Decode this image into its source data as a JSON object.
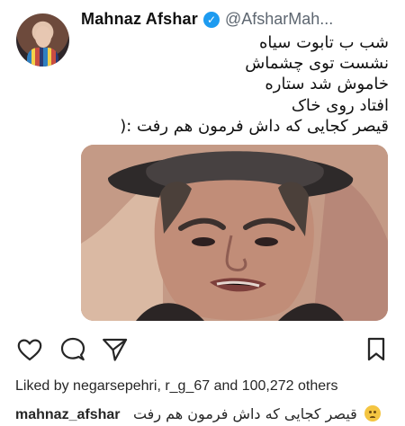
{
  "post": {
    "display_name": "Mahnaz Afshar",
    "handle": "@AfsharMah...",
    "tweet_lines": [
      "شب ب تابوت سیاه",
      "نشست توی چشماش",
      "خاموش شد ستاره",
      "افتاد روی خاک",
      "قیصر کجایی که داش فرمون هم رفت :("
    ]
  },
  "instagram": {
    "likes_text": "Liked by negarsepehri, r_g_67 and 100,272 others",
    "caption_user": "mahnaz_afshar",
    "caption_text": "قیصر کجایی که داش فرمون هم رفت"
  },
  "icons": {
    "like": "heart-outline-icon",
    "comment": "comment-outline-icon",
    "share": "send-outline-icon",
    "save": "bookmark-outline-icon",
    "verified": "verified-check-icon",
    "emoji": "sad-face-emoji-icon"
  }
}
